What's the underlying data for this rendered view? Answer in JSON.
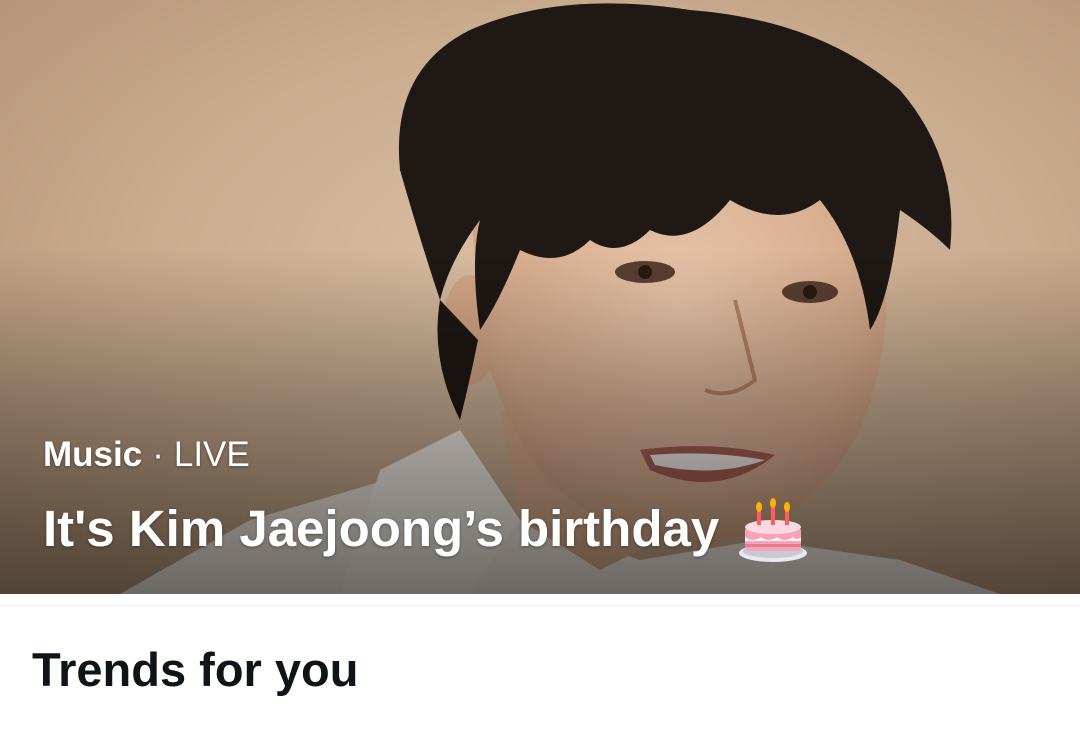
{
  "trend_card": {
    "category": "Music",
    "separator": "·",
    "status": "LIVE",
    "headline": "It's Kim Jaejoong’s birthday",
    "emoji_icon": "birthday-cake-icon",
    "text_color": "#ffffff"
  },
  "section": {
    "title": "Trends for you",
    "title_color": "#0f1419",
    "divider_color": "#eff3f4"
  }
}
